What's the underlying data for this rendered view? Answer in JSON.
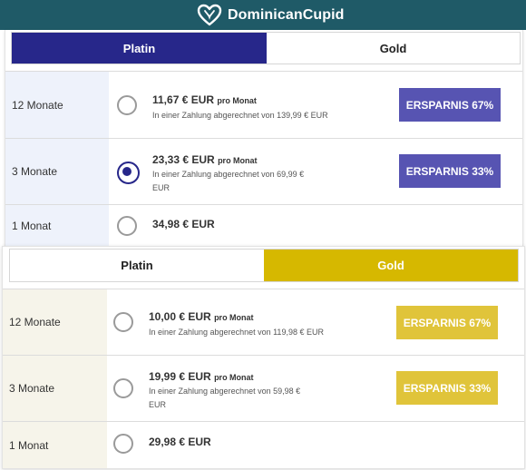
{
  "brand": {
    "name": "DominicanCupid",
    "logo_icon": "heart-logo-icon"
  },
  "colors": {
    "header": "#1f5a67",
    "platin": "#27278a",
    "gold": "#d6b800",
    "platin_button": "#5754b2",
    "gold_button": "#e0c43a"
  },
  "platin": {
    "tabs": {
      "platin": "Platin",
      "gold": "Gold",
      "active": "Platin"
    },
    "rows": [
      {
        "label": "12 Monate",
        "price": "11,67 € EUR",
        "per": "pro Monat",
        "note": "In einer Zahlung abgerechnet von 139,99 € EUR",
        "save": "ERSPARNIS 67%",
        "selected": false
      },
      {
        "label": "3 Monate",
        "price": "23,33 € EUR",
        "per": "pro Monat",
        "note": "In einer Zahlung abgerechnet von 69,99 € EUR",
        "save": "ERSPARNIS 33%",
        "selected": true
      },
      {
        "label": "1 Monat",
        "price": "34,98 € EUR",
        "selected": false
      }
    ]
  },
  "gold": {
    "tabs": {
      "platin": "Platin",
      "gold": "Gold",
      "active": "Gold"
    },
    "rows": [
      {
        "label": "12 Monate",
        "price": "10,00 € EUR",
        "per": "pro Monat",
        "note": "In einer Zahlung abgerechnet von 119,98 € EUR",
        "save": "ERSPARNIS 67%",
        "selected": false
      },
      {
        "label": "3 Monate",
        "price": "19,99 € EUR",
        "per": "pro Monat",
        "note": "In einer Zahlung abgerechnet von 59,98 € EUR",
        "save": "ERSPARNIS 33%",
        "selected": false
      },
      {
        "label": "1 Monat",
        "price": "29,98 € EUR",
        "selected": false
      }
    ]
  }
}
